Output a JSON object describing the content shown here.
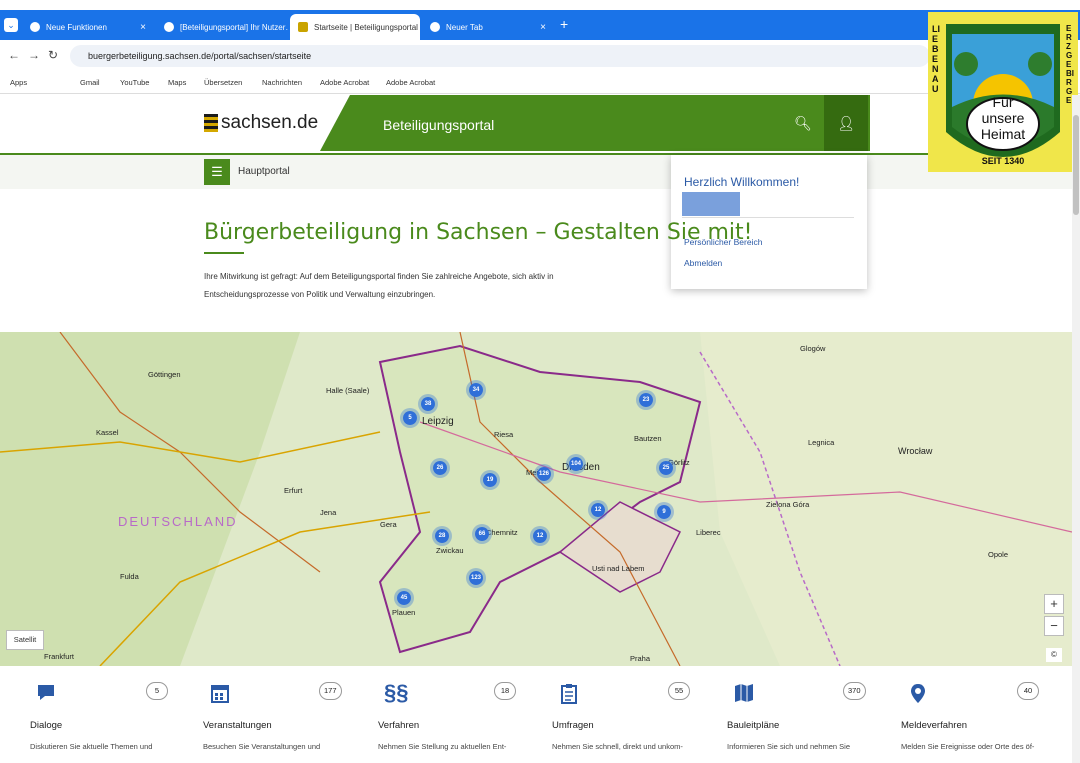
{
  "browser": {
    "tabs": [
      {
        "label": "Neue Funktionen",
        "active": false
      },
      {
        "label": "[Beteiligungsportal] Ihr Nutzer…",
        "active": false
      },
      {
        "label": "Startseite | Beteiligungsportal S…",
        "active": true
      },
      {
        "label": "Neuer Tab",
        "active": false
      }
    ],
    "new_tab_label": "+",
    "url": "buergerbeteiligung.sachsen.de/portal/sachsen/startseite",
    "bookmarks": [
      "Apps",
      "Gmail",
      "YouTube",
      "Maps",
      "Übersetzen",
      "Nachrichten",
      "Adobe Acrobat",
      "Adobe Acrobat"
    ]
  },
  "header": {
    "logo_text": "sachsen.de",
    "portal_title": "Beteiligungsportal",
    "subnav_label": "Hauptportal"
  },
  "user_menu": {
    "greeting": "Herzlich Willkommen!",
    "links": [
      "Persönlicher Bereich",
      "Abmelden"
    ]
  },
  "badge": {
    "ring_left": "LIEBENAU",
    "ring_right": "ERZGEBIRGE",
    "line1": "Für",
    "line2": "unsere",
    "line3": "Heimat",
    "year": "SEIT 1340"
  },
  "main": {
    "title": "Bürgerbeteiligung in Sachsen – Gestalten Sie mit!",
    "intro_line1": "Ihre Mitwirkung ist gefragt: Auf dem Beteiligungsportal finden Sie zahlreiche Angebote, sich aktiv in",
    "intro_line2": "Entscheidungsprozesse von Politik und Verwaltung einzubringen."
  },
  "map": {
    "satellite_label": "Satellit",
    "zoom_in": "+",
    "zoom_out": "−",
    "country_label": "DEUTSCHLAND",
    "clusters": [
      "34",
      "38",
      "5",
      "23",
      "26",
      "19",
      "126",
      "104",
      "25",
      "12",
      "9",
      "28",
      "66",
      "12",
      "123",
      "45"
    ],
    "cities": [
      "Leipzig",
      "Dresden",
      "Chemnitz",
      "Zwickau",
      "Halle (Saale)",
      "Erfurt",
      "Jena",
      "Gera",
      "Göttingen",
      "Kassel",
      "Wrocław",
      "Legnica",
      "Liberec",
      "Usti nad Labem",
      "Praha",
      "Frankfurt",
      "Fulda",
      "Opole",
      "Glogów",
      "Zielona Góra",
      "Bautzen",
      "Görlitz",
      "Riesa",
      "Meißen",
      "Plauen"
    ]
  },
  "categories": [
    {
      "icon": "chat-icon",
      "count": "5",
      "title": "Dialoge",
      "desc": "Diskutieren Sie aktuelle Themen und"
    },
    {
      "icon": "calendar-icon",
      "count": "177",
      "title": "Veranstaltungen",
      "desc": "Besuchen Sie Veranstaltungen und"
    },
    {
      "icon": "paragraph-icon",
      "count": "18",
      "title": "Verfahren",
      "desc": "Nehmen Sie Stellung zu aktuellen Ent-"
    },
    {
      "icon": "clipboard-icon",
      "count": "55",
      "title": "Umfragen",
      "desc": "Nehmen Sie schnell, direkt und unkom-"
    },
    {
      "icon": "map-icon",
      "count": "370",
      "title": "Bauleitpläne",
      "desc": "Informieren Sie sich und nehmen Sie"
    },
    {
      "icon": "pin-icon",
      "count": "40",
      "title": "Meldeverfahren",
      "desc": "Melden Sie Ereignisse oder Orte des öf-"
    }
  ],
  "colors": {
    "accent_green": "#4a8a1c",
    "cluster_blue": "#2f6fd8",
    "chrome_blue": "#1a73e8"
  }
}
